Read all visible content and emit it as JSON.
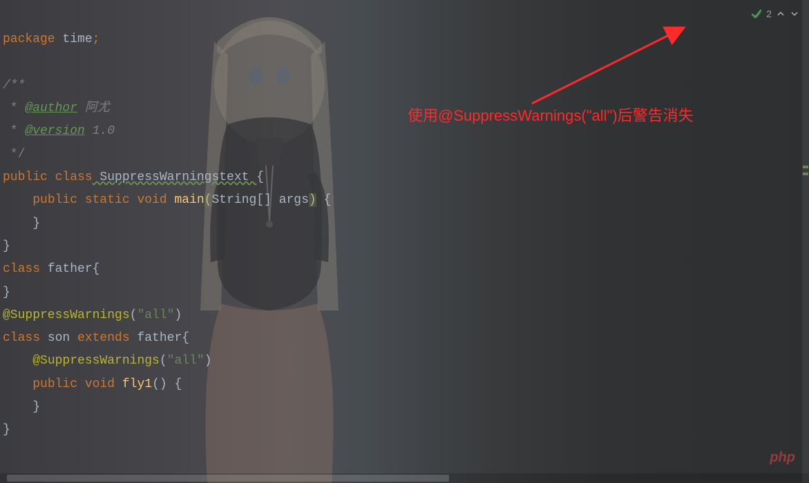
{
  "inspection": {
    "count": "2"
  },
  "annotation": {
    "text": "使用@SuppressWarnings(\"all\")后警告消失"
  },
  "code": {
    "l1_kw": "package",
    "l1_name": " time",
    "l1_semi": ";",
    "l3_open": "/**",
    "l4_star": " * ",
    "l4_tag": "@author",
    "l4_val": " 阿尤",
    "l5_star": " * ",
    "l5_tag": "@version",
    "l5_val": " 1.0",
    "l6_close": " */",
    "l7_kw1": "public class",
    "l7_name": " SuppressWarningstext ",
    "l7_brace": "{",
    "l8_indent": "    ",
    "l8_kw": "public static void",
    "l8_fn": " main",
    "l8_p1": "(",
    "l8_type": "String[] args",
    "l8_p2": ")",
    "l8_brace": " {",
    "l9": "    }",
    "l10": "}",
    "l11_kw": "class",
    "l11_name": " father{",
    "l12": "}",
    "l13_ann": "@SuppressWarnings",
    "l13_p1": "(",
    "l13_str": "\"all\"",
    "l13_p2": ")",
    "l14_kw1": "class",
    "l14_name": " son ",
    "l14_kw2": "extends",
    "l14_super": " father{",
    "l15_indent": "    ",
    "l15_ann": "@SuppressWarnings",
    "l15_p1": "(",
    "l15_str": "\"all\"",
    "l15_p2": ")",
    "l16_indent": "    ",
    "l16_kw": "public void",
    "l16_fn": " fly1",
    "l16_paren": "() ",
    "l16_brace": "{",
    "l17": "    }",
    "l18": "}"
  },
  "watermark": {
    "p1": "php",
    "p2": ""
  }
}
